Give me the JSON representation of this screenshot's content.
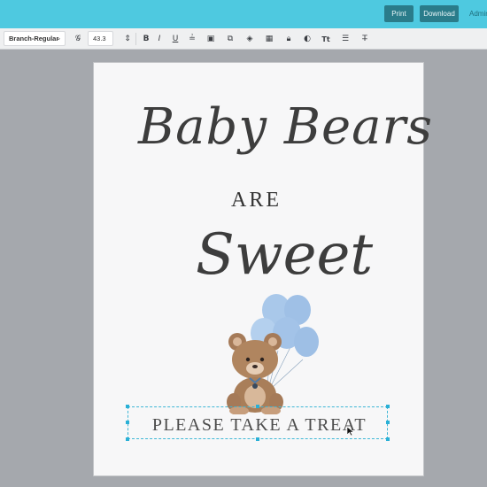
{
  "topbar": {
    "print_label": "Print",
    "download_label": "Download",
    "admin_label": "Admin"
  },
  "toolbar": {
    "font_name": "Branch-Regular",
    "font_size": "43.3",
    "icons": [
      "font-style-icon",
      "line-height-icon",
      "bold-icon",
      "italic-icon",
      "underline-icon",
      "align-icon",
      "image-icon",
      "duplicate-icon",
      "layer-icon",
      "stamp-icon",
      "lock-icon",
      "color-icon",
      "text-case-icon",
      "list-icon",
      "clear-format-icon"
    ],
    "bold_label": "B",
    "italic_label": "I",
    "underline_label": "U",
    "text_case_label": "Tt"
  },
  "document": {
    "title_line1": "Baby Bears",
    "title_line2": "ARE",
    "title_line3": "Sweet",
    "bottom_text": "PLEASE TAKE A TREAT"
  },
  "colors": {
    "topbar": "#4ec9e0",
    "button": "#2a7c8a",
    "selection": "#3fb7d6",
    "balloon": "#a9c8ea"
  }
}
